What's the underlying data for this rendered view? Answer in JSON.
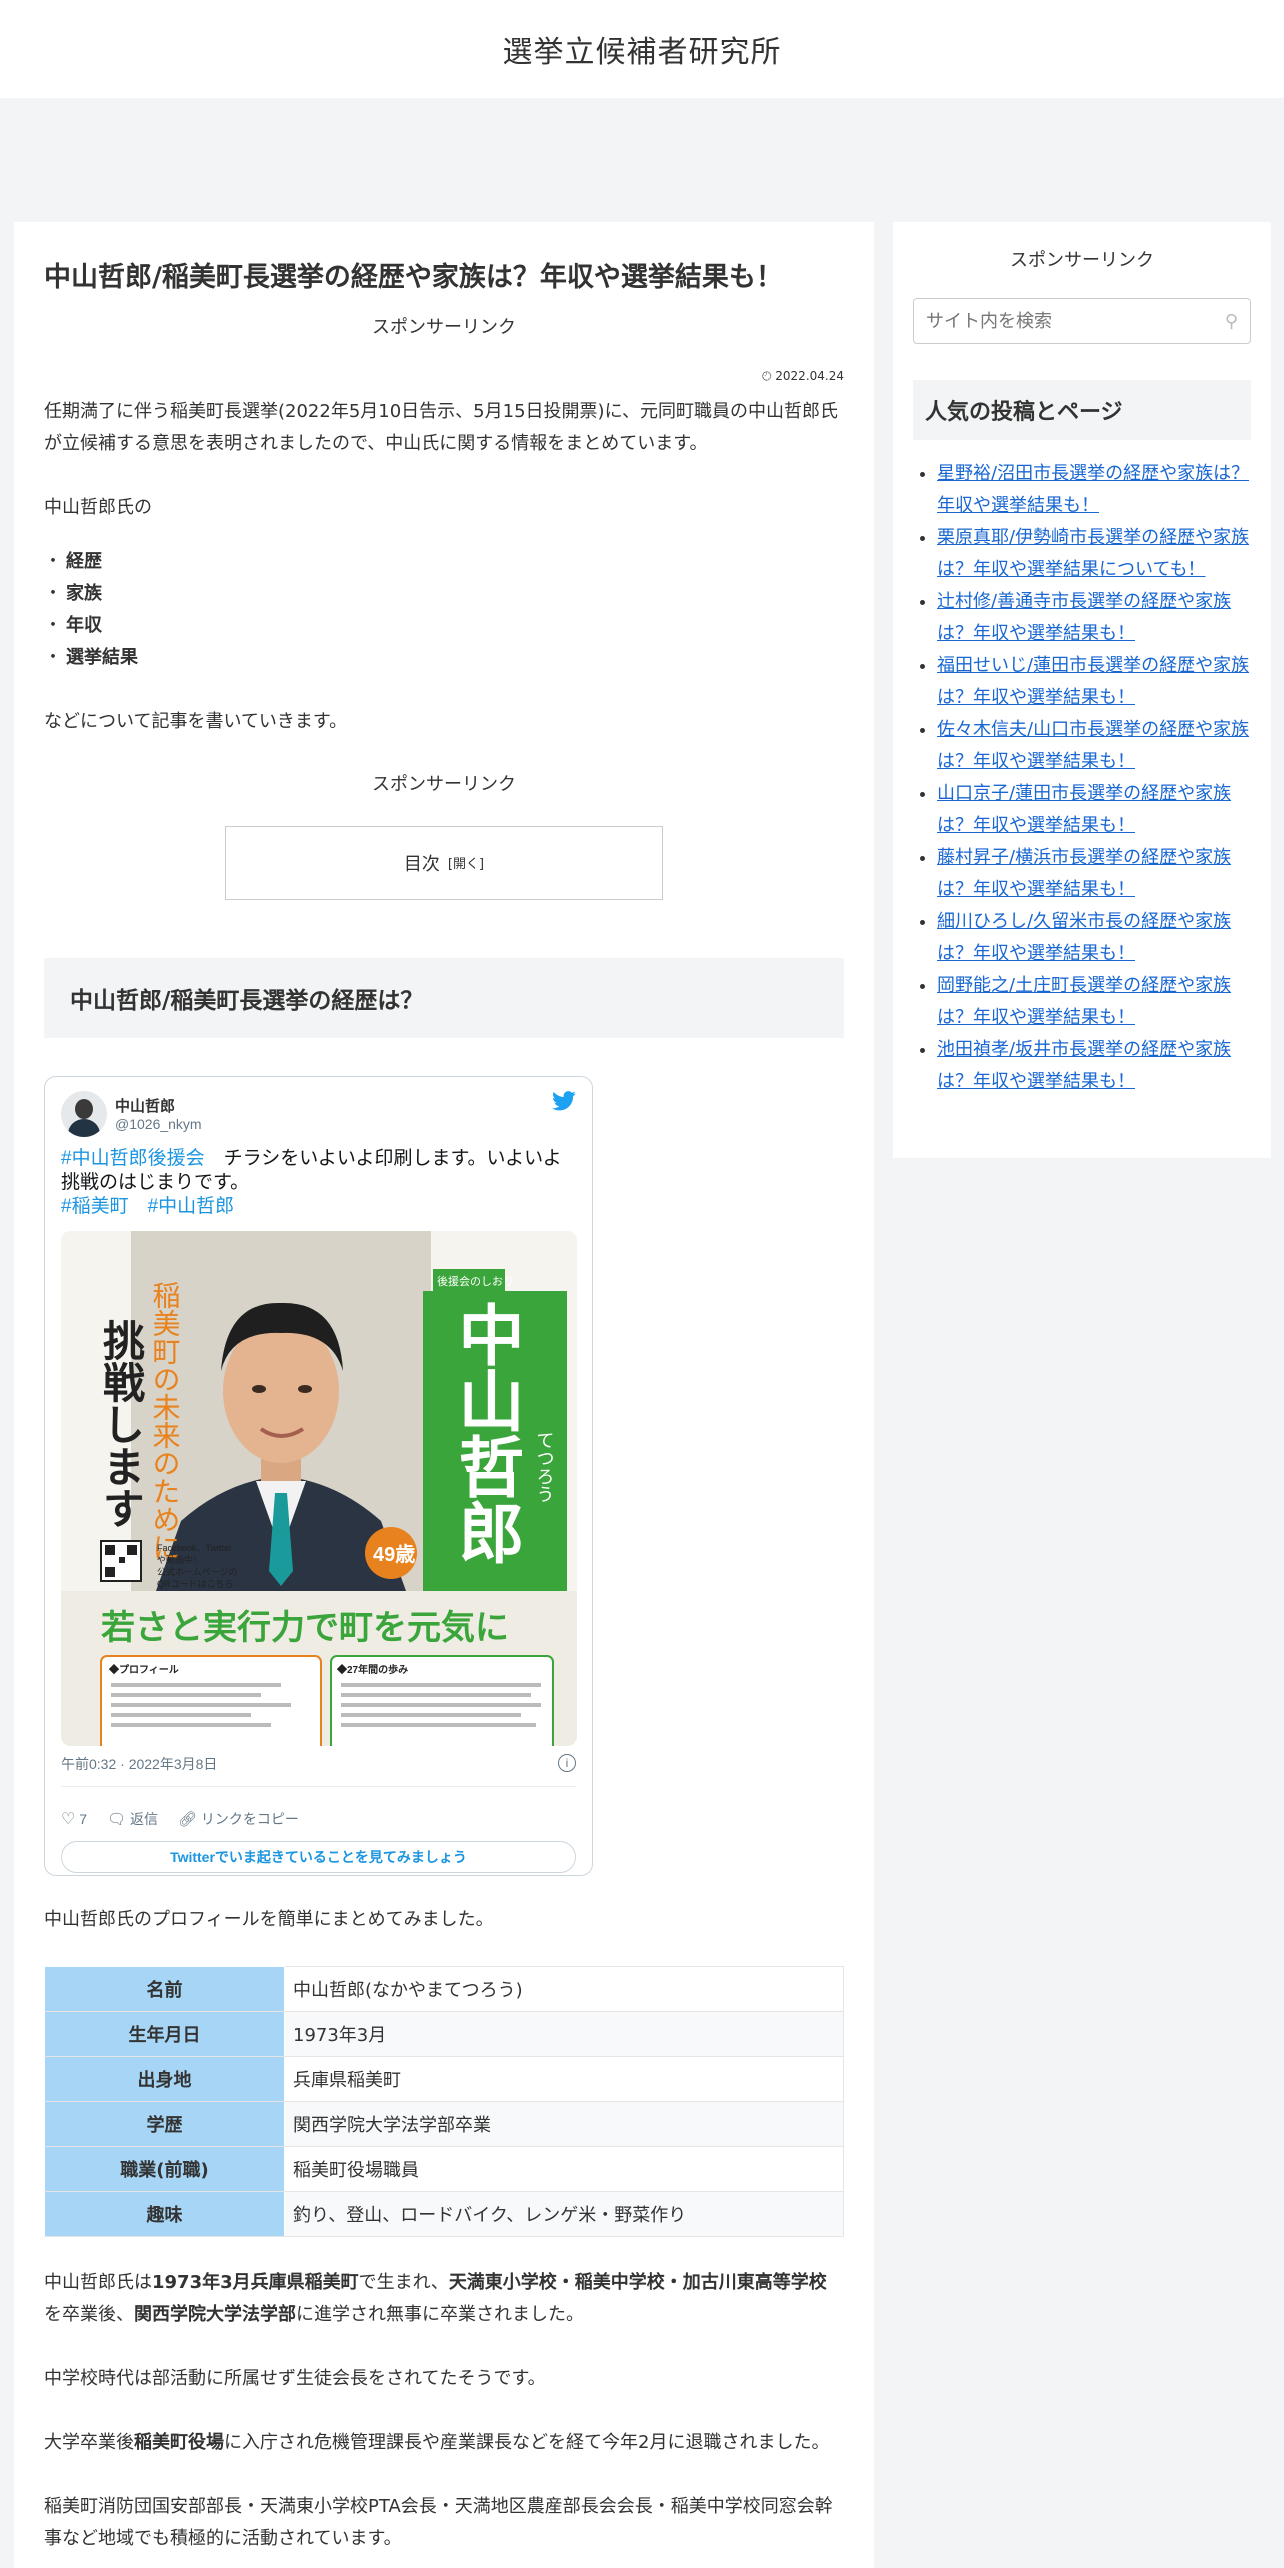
{
  "site": {
    "title": "選挙立候補者研究所"
  },
  "article": {
    "title": "中山哲郎/稲美町長選挙の経歴や家族は？年収や選挙結果も！",
    "sponsor1": "スポンサーリンク",
    "date": "2022.04.24",
    "intro": "任期満了に伴う稲美町長選挙(2022年5月10日告示、5月15日投開票)に、元同町職員の中山哲郎氏が立候補する意思を表明されましたので、中山氏に関する情報をまとめています。",
    "lead": "中山哲郎氏の",
    "keywords": [
      "経歴",
      "家族",
      "年収",
      "選挙結果"
    ],
    "after_keywords": "などについて記事を書いていきます。",
    "sponsor2": "スポンサーリンク",
    "toc": {
      "label": "目次",
      "toggle": "[開く]"
    },
    "h2": "中山哲郎/稲美町長選挙の経歴は？",
    "tweet": {
      "name": "中山哲郎",
      "handle": "@1026_nkym",
      "tag1": "#中山哲郎後援会",
      "text1": "　チラシをいよいよ印刷します。いよいよ挑戦のはじまりです。",
      "tag2": "#稲美町",
      "tag3": "#中山哲郎",
      "time": "午前0:32 · 2022年3月8日",
      "likes": "7",
      "reply": "返信",
      "copy": "リンクをコピー",
      "cta": "Twitterでいま起きていることを見てみましょう",
      "flyer": {
        "badge": "後援会のしおり",
        "name": "中山哲郎",
        "reading": "てつろう",
        "side1": "稲美町の未来のために",
        "side2": "挑戦します",
        "age": "49歳",
        "qr_note": "Facebook、Twitter\nや動画中！\n公式ホームページの\nQRコードはこちら",
        "slogan": "若さと実行力で町を元気に",
        "profile_head": "◆プロフィール",
        "history_head": "◆27年間の歩み"
      }
    },
    "profile_intro": "中山哲郎氏のプロフィールを簡単にまとめてみました。",
    "profile": [
      {
        "k": "名前",
        "v": "中山哲郎(なかやまてつろう)"
      },
      {
        "k": "生年月日",
        "v": "1973年3月"
      },
      {
        "k": "出身地",
        "v": "兵庫県稲美町"
      },
      {
        "k": "学歴",
        "v": "関西学院大学法学部卒業"
      },
      {
        "k": "職業(前職)",
        "v": "稲美町役場職員"
      },
      {
        "k": "趣味",
        "v": "釣り、登山、ロードバイク、レンゲ米・野菜作り"
      }
    ],
    "bio": {
      "p1a": "中山哲郎氏は",
      "p1b": "1973年3月兵庫県稲美町",
      "p1c": "で生まれ、",
      "p1d": "天満東小学校・稲美中学校・加古川東高等学校",
      "p1e": "を卒業後、",
      "p1f": "関西学院大学法学部",
      "p1g": "に進学され無事に卒業されました。",
      "p2": "中学校時代は部活動に所属せず生徒会長をされてたそうです。",
      "p3a": "大学卒業後",
      "p3b": "稲美町役場",
      "p3c": "に入庁され危機管理課長や産業課長などを経て今年2月に退職されました。",
      "p4": "稲美町消防団国安部部長・天満東小学校PTA会長・天満地区農産部長会会長・稲美中学校同窓会幹事など地域でも積極的に活動されています。"
    }
  },
  "sidebar": {
    "sponsor": "スポンサーリンク",
    "search_placeholder": "サイト内を検索",
    "widget_title": "人気の投稿とページ",
    "popular": [
      "星野裕/沼田市長選挙の経歴や家族は？年収や選挙結果も！",
      "栗原真耶/伊勢崎市長選挙の経歴や家族は？年収や選挙結果についても！",
      "辻村修/善通寺市長選挙の経歴や家族は？年収や選挙結果も！",
      "福田せいじ/蓮田市長選挙の経歴や家族は？年収や選挙結果も！",
      "佐々木信夫/山口市長選挙の経歴や家族は？年収や選挙結果も！",
      "山口京子/蓮田市長選挙の経歴や家族は？年収や選挙結果も！",
      "藤村昇子/横浜市長選挙の経歴や家族は？年収や選挙結果も！",
      "細川ひろし/久留米市長の経歴や家族は？年収や選挙結果も！",
      "岡野能之/土庄町長選挙の経歴や家族は？年収や選挙結果も！",
      "池田禎孝/坂井市長選挙の経歴や家族は？年収や選挙結果も！"
    ]
  },
  "colors": {
    "link": "#1967d2",
    "table_head": "#a6d5f5",
    "flyer_green": "#3aa53a",
    "flyer_orange": "#e8821e"
  }
}
